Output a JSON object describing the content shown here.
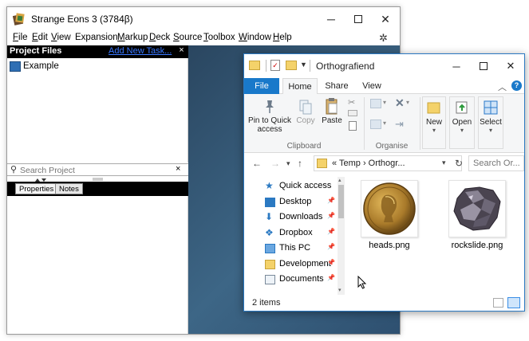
{
  "strange_eons": {
    "title": "Strange Eons 3 (3784β)",
    "menu": [
      {
        "u": "F",
        "rest": "ile"
      },
      {
        "u": "E",
        "rest": "dit"
      },
      {
        "u": "V",
        "rest": "iew"
      },
      {
        "u": "",
        "rest": "Expansion"
      },
      {
        "u": "M",
        "rest": "arkup"
      },
      {
        "u": "D",
        "rest": "eck"
      },
      {
        "u": "S",
        "rest": "ource"
      },
      {
        "u": "T",
        "rest": "oolbox"
      },
      {
        "u": "W",
        "rest": "indow"
      },
      {
        "u": "H",
        "rest": "elp"
      }
    ],
    "project": {
      "header": "Project Files",
      "add_task": "Add New Task...",
      "close": "×",
      "root": "Example",
      "search_placeholder": "Search Project",
      "search_clear": "×",
      "tabs": [
        "Properties",
        "Notes"
      ]
    },
    "colors": {
      "accent_link": "#3a78ff",
      "editor_bg": "#3d6686"
    }
  },
  "explorer": {
    "title": "Orthografiend",
    "tabs": {
      "file": "File",
      "home": "Home",
      "share": "Share",
      "view": "View"
    },
    "ribbon": {
      "pin": [
        "Pin to Quick",
        "access"
      ],
      "copy": "Copy",
      "paste": "Paste",
      "clipboard": "Clipboard",
      "organise": "Organise",
      "new": "New",
      "open": "Open",
      "select": "Select"
    },
    "address": {
      "prefix": "«",
      "path": "Temp  ›  Orthogr...",
      "search_placeholder": "Search Or..."
    },
    "nav": [
      {
        "label": "Quick access",
        "icon": "star-icon",
        "pinned": false
      },
      {
        "label": "Desktop",
        "icon": "desktop-icon",
        "pinned": true
      },
      {
        "label": "Downloads",
        "icon": "download-icon",
        "pinned": true
      },
      {
        "label": "Dropbox",
        "icon": "dropbox-icon",
        "pinned": true
      },
      {
        "label": "This PC",
        "icon": "computer-icon",
        "pinned": true
      },
      {
        "label": "Development",
        "icon": "folder-icon",
        "pinned": true
      },
      {
        "label": "Documents",
        "icon": "documents-icon",
        "pinned": true
      }
    ],
    "files": [
      {
        "name": "heads.png",
        "thumb": "coin-image"
      },
      {
        "name": "rockslide.png",
        "thumb": "rock-image"
      }
    ],
    "status": {
      "count": "2 items"
    },
    "colors": {
      "file_tab": "#1979ca",
      "folder": "#f4d26a"
    }
  }
}
